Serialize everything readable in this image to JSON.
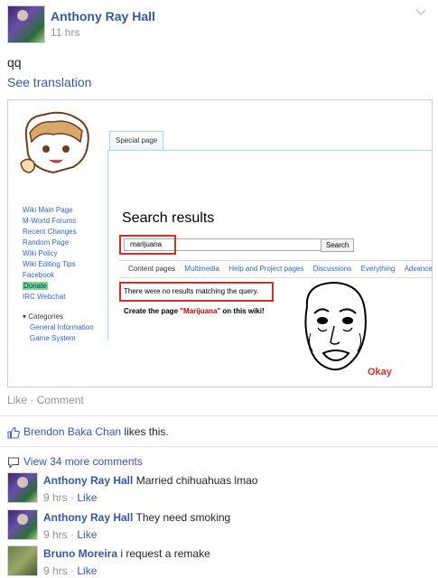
{
  "post": {
    "author": "Anthony Ray Hall",
    "time": "11 hrs",
    "text": "qq",
    "see_translation": "See translation"
  },
  "image": {
    "special_page_tab": "Special page",
    "sidebar_links": [
      "Wiki Main Page",
      "M-World Forums",
      "Recent Changes",
      "Random Page",
      "Wiki Policy",
      "Wiki Editing Tips",
      "Facebook",
      "Donate",
      "IRC Webchat"
    ],
    "categories_label": "Categories",
    "category_links": [
      "General Information",
      "Game System"
    ],
    "search_results_title": "Search results",
    "search_value": "marijuana",
    "search_button": "Search",
    "tabs": [
      "Content pages",
      "Multimedia",
      "Help and Project pages",
      "Discussions",
      "Everything",
      "Advanced"
    ],
    "no_results": "There were no results matching the query.",
    "create_prefix": "Create the page ",
    "create_term": "\"Marijuana\"",
    "create_suffix": " on this wiki!",
    "okay_text": "Okay"
  },
  "actions": {
    "like": "Like",
    "sep": " · ",
    "comment": "Comment"
  },
  "likes": {
    "name": "Brendon Baka Chan",
    "suffix": " likes this."
  },
  "more_comments": "View 34 more comments",
  "comments": [
    {
      "name": "Anthony Ray Hall",
      "text": "Married chihuahuas lmao",
      "time": "9 hrs",
      "like": "Like"
    },
    {
      "name": "Anthony Ray Hall",
      "text": "They need smoking",
      "time": "9 hrs",
      "like": "Like"
    },
    {
      "name": "Bruno Moreira",
      "text": "i request a remake",
      "time": "9 hrs",
      "like": "Like"
    }
  ],
  "colors": {
    "link": "#365899",
    "meta": "#90949c",
    "highlight_red": "#d0302a",
    "donate_green": "#7ad97a"
  }
}
